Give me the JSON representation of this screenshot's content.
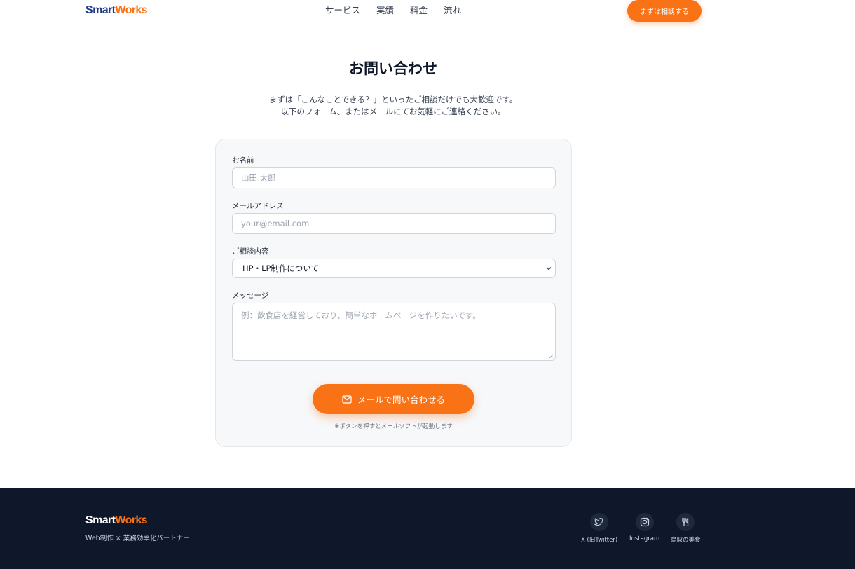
{
  "header": {
    "logo_part1": "Smart",
    "logo_part2": "Works",
    "nav": [
      "サービス",
      "実績",
      "料金",
      "流れ"
    ],
    "cta_label": "まずは相談する"
  },
  "page": {
    "title": "お問い合わせ",
    "intro_line1": "まずは「こんなことできる？」といったご相談だけでも大歓迎です。",
    "intro_line2": "以下のフォーム、またはメールにてお気軽にご連絡ください。"
  },
  "form": {
    "name_label": "お名前",
    "name_placeholder": "山田 太郎",
    "email_label": "メールアドレス",
    "email_placeholder": "your@email.com",
    "topic_label": "ご相談内容",
    "topic_selected": "HP・LP制作について",
    "message_label": "メッセージ",
    "message_placeholder": "例：飲食店を経営しており、簡単なホームページを作りたいです。",
    "submit_label": "メールで問い合わせる",
    "note": "※ボタンを押すとメールソフトが起動します"
  },
  "footer": {
    "logo_part1": "Smart",
    "logo_part2": "Works",
    "tagline": "Web制作 × 業務効率化パートナー",
    "social": [
      {
        "label": "X (旧Twitter)",
        "icon": "twitter-bird-icon"
      },
      {
        "label": "Instagram",
        "icon": "instagram-icon"
      },
      {
        "label": "鳥取の美食",
        "icon": "fork-knife-icon"
      }
    ]
  },
  "colors": {
    "accent": "#f97316",
    "brand_navy": "#1e3a8a",
    "footer_bg": "#0f172a"
  }
}
